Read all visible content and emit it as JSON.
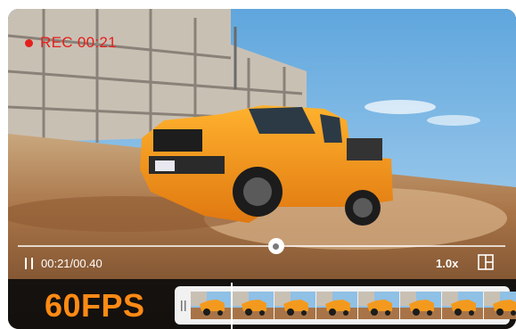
{
  "recording": {
    "label": "REC 00:21",
    "indicator_color": "#e4201c"
  },
  "player": {
    "time": "00:21/00.40",
    "speed": "1.0x",
    "progress": 0.53
  },
  "bottom": {
    "fps_label": "60FPS",
    "fps_color": "#ff8a15",
    "frames_count": 8
  },
  "icons": {
    "pause": "pause-icon",
    "layout": "layout-icon",
    "handle": "drag-handle-icon"
  }
}
